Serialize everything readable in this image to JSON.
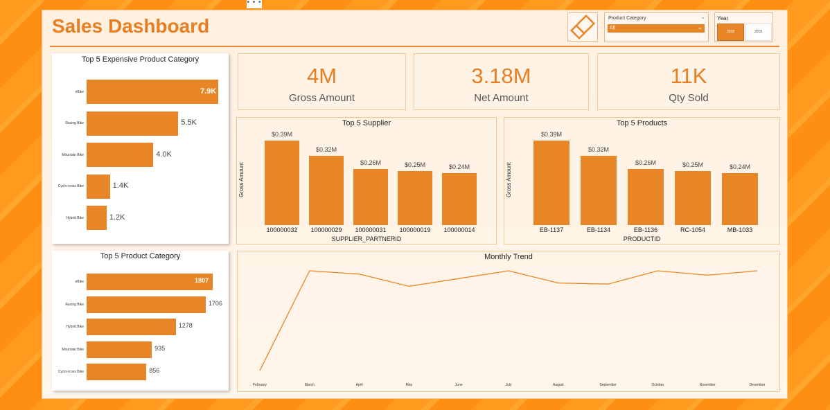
{
  "header": {
    "title": "Sales Dashboard",
    "more_options": "• • •"
  },
  "slicers": {
    "product_category": {
      "label": "Product Category",
      "selected": "All"
    },
    "year": {
      "label": "Year",
      "options": [
        "2018",
        "2019"
      ],
      "selected": "2018"
    }
  },
  "kpis": [
    {
      "value": "4M",
      "label": "Gross Amount"
    },
    {
      "value": "3.18M",
      "label": "Net Amount"
    },
    {
      "value": "11K",
      "label": "Qty Sold"
    }
  ],
  "colors": {
    "accent": "#e88526",
    "title": "#e87e22",
    "background": "#ff9a1f"
  },
  "chart_data": [
    {
      "type": "bar",
      "orientation": "horizontal",
      "title": "Top 5 Expensive Product Category",
      "categories": [
        "eBike",
        "Racing Bike",
        "Mountain Bike",
        "Cyclo-cross Bike",
        "Hybrid Bike"
      ],
      "values": [
        7900,
        5500,
        4000,
        1400,
        1200
      ],
      "labels": [
        "7.9K",
        "5.5K",
        "4.0K",
        "1.4K",
        "1.2K"
      ]
    },
    {
      "type": "bar",
      "orientation": "horizontal",
      "title": "Top 5 Product Category",
      "categories": [
        "eBike",
        "Racing Bike",
        "Hybrid Bike",
        "Mountain Bike",
        "Cyclo-cross Bike"
      ],
      "values": [
        1807,
        1706,
        1278,
        935,
        856
      ],
      "labels": [
        "1807",
        "1706",
        "1278",
        "935",
        "856"
      ]
    },
    {
      "type": "bar",
      "title": "Top 5 Supplier",
      "xlabel": "SUPPLIER_PARTNERID",
      "ylabel": "Gross Amount",
      "categories": [
        "100000032",
        "100000029",
        "100000031",
        "100000019",
        "100000014"
      ],
      "values": [
        0.39,
        0.32,
        0.26,
        0.25,
        0.24
      ],
      "labels": [
        "$0.39M",
        "$0.32M",
        "$0.26M",
        "$0.25M",
        "$0.24M"
      ]
    },
    {
      "type": "bar",
      "title": "Top 5 Products",
      "xlabel": "PRODUCTID",
      "ylabel": "Gross Amount",
      "categories": [
        "EB-1137",
        "EB-1134",
        "EB-1136",
        "RC-1054",
        "MB-1033"
      ],
      "values": [
        0.39,
        0.32,
        0.26,
        0.25,
        0.24
      ],
      "labels": [
        "$0.39M",
        "$0.32M",
        "$0.26M",
        "$0.25M",
        "$0.24M"
      ]
    },
    {
      "type": "line",
      "title": "Monthly Trend",
      "x": [
        "February",
        "March",
        "April",
        "May",
        "June",
        "July",
        "August",
        "September",
        "October",
        "November",
        "December"
      ],
      "values": [
        0.05,
        0.95,
        0.92,
        0.81,
        0.88,
        0.95,
        0.84,
        0.83,
        0.95,
        0.91,
        0.95
      ]
    }
  ]
}
